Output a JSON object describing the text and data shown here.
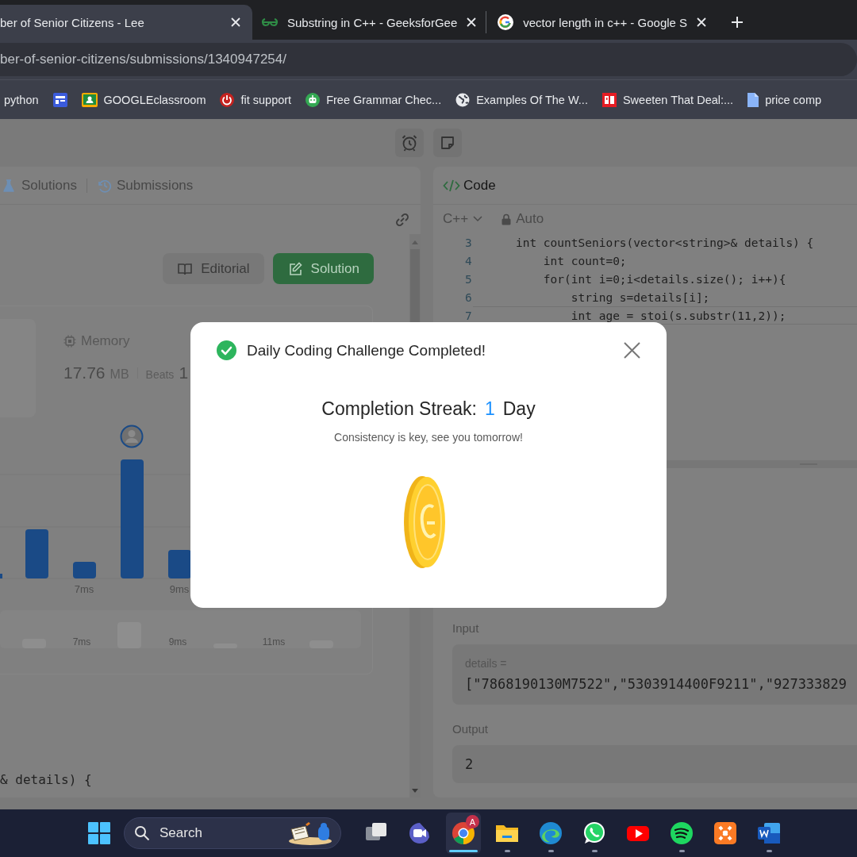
{
  "browser_tabs": [
    {
      "title": "ber of Senior Citizens - Lee",
      "selected": true
    },
    {
      "title": "Substring in C++ - GeeksforGee",
      "selected": false
    },
    {
      "title": "vector length in c++ - Google S",
      "selected": false
    }
  ],
  "address": "ber-of-senior-citizens/submissions/1340947254/",
  "bookmarks": [
    "python",
    "GOOGLEclassroom",
    "fit support",
    "Free Grammar Chec...",
    "Examples Of The W...",
    "Sweeten That Deal:...",
    "price comp"
  ],
  "left_panel": {
    "tabs": [
      {
        "label": "Solutions",
        "selected": false
      },
      {
        "label": "Submissions",
        "selected": false
      }
    ],
    "actions": [
      {
        "label": "Editorial",
        "kind": "secondary"
      },
      {
        "label": "Solution",
        "kind": "primary"
      }
    ],
    "memory": {
      "label": "Memory",
      "value": "17.76",
      "unit": "MB",
      "beats_label": "Beats",
      "beats_value": "1"
    },
    "chart_labels": [
      "7ms",
      "9ms"
    ],
    "overview_labels": [
      "7ms",
      "9ms",
      "11ms"
    ],
    "code_snippet": "& details) {"
  },
  "code_panel": {
    "title": "Code",
    "language": "C++",
    "mode": "Auto",
    "lines": [
      {
        "number": "3",
        "text": "    int countSeniors(vector<string>& details) {",
        "highlighted": false
      },
      {
        "number": "4",
        "text": "        int count=0;",
        "highlighted": false
      },
      {
        "number": "5",
        "text": "        for(int i=0;i<details.size(); i++){",
        "highlighted": false
      },
      {
        "number": "6",
        "text": "            string s=details[i];",
        "highlighted": false
      },
      {
        "number": "7",
        "text": "            int age = stoi(s.substr(11,2));",
        "highlighted": true
      }
    ]
  },
  "testcase": {
    "input_label": "Input",
    "param": "details =",
    "input_value": "[\"7868190130M7522\",\"5303914400F9211\",\"927333829",
    "output_label": "Output",
    "output_value": "2"
  },
  "modal": {
    "title": "Daily Coding Challenge Completed!",
    "streak_label": "Completion Streak:",
    "streak_count": "1",
    "streak_unit": "Day",
    "message": "Consistency is key, see you tomorrow!"
  },
  "taskbar": {
    "search_placeholder": "Search",
    "apps": [
      {
        "running": false,
        "active": false
      },
      {
        "running": false,
        "active": false
      },
      {
        "running": true,
        "active": true,
        "badge": "A"
      },
      {
        "running": true,
        "active": false
      },
      {
        "running": true,
        "active": false
      },
      {
        "running": true,
        "active": false
      },
      {
        "running": false,
        "active": false
      },
      {
        "running": true,
        "active": false
      },
      {
        "running": false,
        "active": false
      },
      {
        "running": true,
        "active": false
      }
    ]
  }
}
